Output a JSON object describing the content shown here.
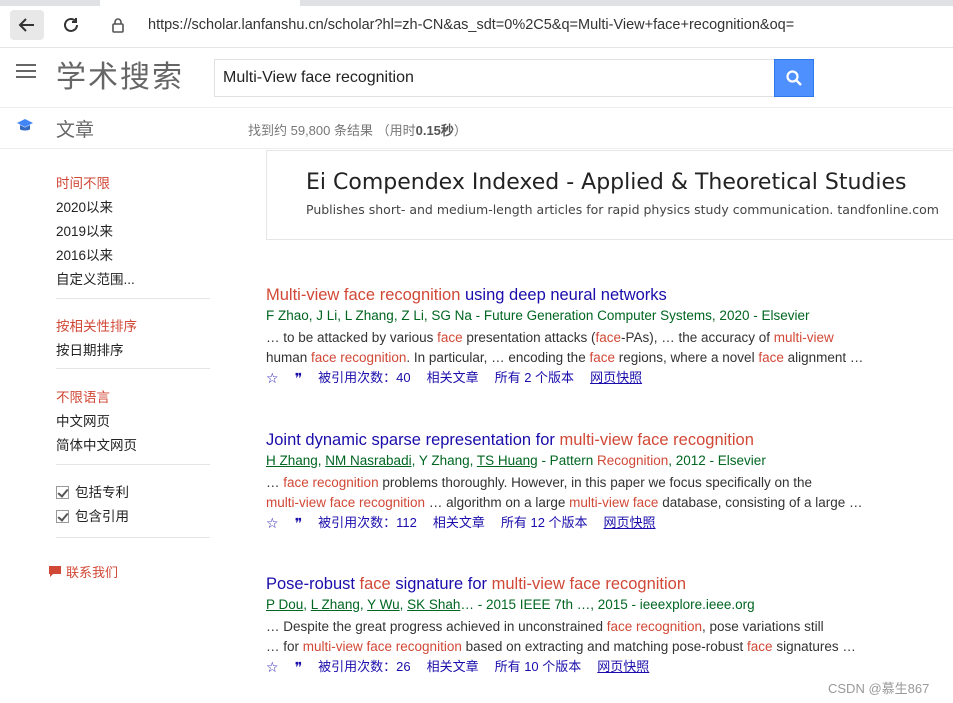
{
  "browser": {
    "url": "https://scholar.lanfanshu.cn/scholar?hl=zh-CN&as_sdt=0%2C5&q=Multi-View+face+recognition&oq="
  },
  "header": {
    "logo": "学术搜索",
    "search_value": "Multi-View face recognition"
  },
  "subbar": {
    "articles_label": "文章",
    "stats_prefix": "找到约 59,800 条结果 （用时",
    "stats_time": "0.15秒",
    "stats_suffix": "）"
  },
  "sidebar": {
    "time_any": "时间不限",
    "since_2020": "2020以来",
    "since_2019": "2019以来",
    "since_2016": "2016以来",
    "custom_range": "自定义范围...",
    "sort_relevance": "按相关性排序",
    "sort_date": "按日期排序",
    "lang_any": "不限语言",
    "lang_zh_web": "中文网页",
    "lang_zh_simplified": "简体中文网页",
    "include_patents": "包括专利",
    "include_citations": "包含引用",
    "contact": "联系我们"
  },
  "ad": {
    "title": "Ei Compendex Indexed - Applied & Theoretical Studies",
    "description": "Publishes short- and medium-length articles for rapid physics study communication. tandfonline.com"
  },
  "results": [
    {
      "title_hl1": "Multi-view face recognition",
      "title_rest": " using deep neural networks",
      "authors_plain": "F Zhao, J Li, L Zhang, Z Li, SG Na - Future Generation Computer Systems, 2020 - Elsevier",
      "snip1_a": "… to be attacked by various ",
      "snip1_b": "face",
      "snip1_c": " presentation attacks (",
      "snip1_d": "face",
      "snip1_e": "-PAs), … the accuracy of ",
      "snip1_f": "multi-view",
      "snip2_a": "human ",
      "snip2_b": "face recognition",
      "snip2_c": ". In particular, … encoding the ",
      "snip2_d": "face",
      "snip2_e": " regions, where a novel ",
      "snip2_f": "face",
      "snip2_g": " alignment …",
      "cited": "被引用次数：40",
      "related": "相关文章",
      "versions": "所有 2 个版本",
      "cache": "网页快照"
    },
    {
      "title_a": "Joint dynamic sparse representation for ",
      "title_hl": "multi-view face recognition",
      "au1": "H Zhang",
      "au2": "NM Nasrabadi",
      "au3": ", Y Zhang, ",
      "au4": "TS Huang",
      "venue_a": " - Pattern ",
      "venue_hl": "Recognition",
      "venue_b": ", 2012 - Elsevier",
      "snip1_a": "… ",
      "snip1_b": "face recognition",
      "snip1_c": " problems thoroughly. However, in this paper we focus specifically on the",
      "snip2_a": "multi-view face recognition",
      "snip2_b": " … algorithm on a large ",
      "snip2_c": "multi-view face",
      "snip2_d": " database, consisting of a large …",
      "cited": "被引用次数：112",
      "related": "相关文章",
      "versions": "所有 12 个版本",
      "cache": "网页快照"
    },
    {
      "title_a": "Pose-robust ",
      "title_hl1": "face",
      "title_b": " signature for ",
      "title_hl2": "multi-view face recognition",
      "au1": "P Dou",
      "au2": "L Zhang",
      "au3": "Y Wu",
      "au4": "SK Shah",
      "venue": "… - 2015 IEEE 7th …, 2015 - ieeexplore.ieee.org",
      "snip1_a": "… Despite the great progress achieved in unconstrained ",
      "snip1_b": "face recognition",
      "snip1_c": ", pose variations still",
      "snip2_a": "… for ",
      "snip2_b": "multi-view face recognition",
      "snip2_c": " based on extracting and matching pose-robust ",
      "snip2_d": "face",
      "snip2_e": " signatures …",
      "cited": "被引用次数：26",
      "related": "相关文章",
      "versions": "所有 10 个版本",
      "cache": "网页快照"
    }
  ],
  "icons": {
    "star": "☆",
    "quote": "❞"
  },
  "watermark": "CSDN @慕生867",
  "colors": {
    "link": "#1a0dab",
    "highlight": "#d14836",
    "author_green": "#006621",
    "search_blue": "#4d90fe"
  }
}
